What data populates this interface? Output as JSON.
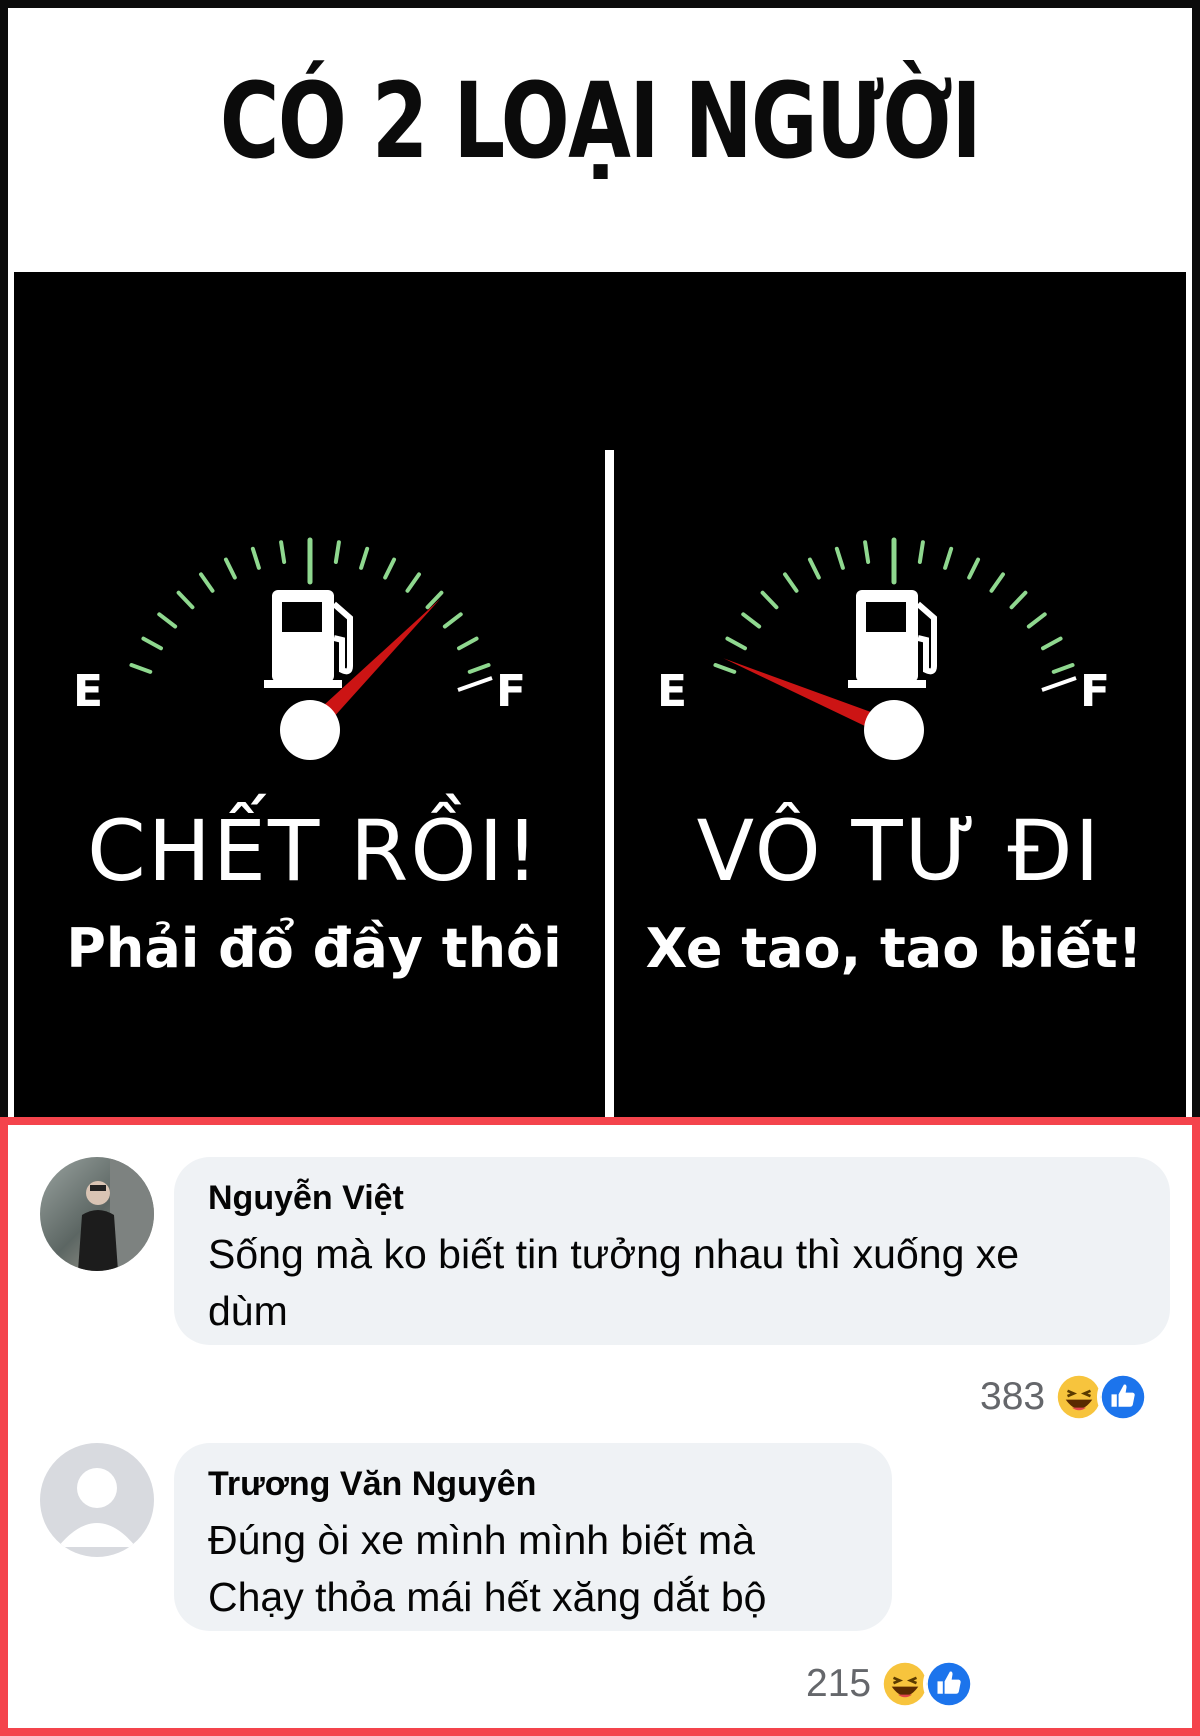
{
  "meme": {
    "title": "CÓ 2 LOẠI NGƯỜI",
    "left_gauge": {
      "empty_label": "E",
      "full_label": "F",
      "level": 0.82,
      "caption": "CHẾT RỒI!",
      "subcaption": "Phải đổ đầy thôi"
    },
    "right_gauge": {
      "empty_label": "E",
      "full_label": "F",
      "level": 0.02,
      "caption": "VÔ TƯ ĐI",
      "subcaption": "Xe tao, tao biết!"
    },
    "colors": {
      "tick": "#8fd88f",
      "needle": "#cc1414",
      "text": "#ffffff",
      "panel": "#000000"
    }
  },
  "comments": [
    {
      "author": "Nguyễn Việt",
      "lines": [
        "Sống mà ko biết tin tưởng nhau thì xuống xe",
        "dùm"
      ],
      "reaction_count": "383",
      "avatar_icon": "user-photo-avatar"
    },
    {
      "author": "Trương Văn Nguyên",
      "lines": [
        "Đúng òi xe mình mình biết mà",
        "Chạy thỏa mái hết xăng dắt bộ"
      ],
      "reaction_count": "215",
      "avatar_icon": "default-user-avatar"
    }
  ],
  "reaction_icons": [
    "haha-icon",
    "like-icon"
  ],
  "highlight_color": "#f4444c"
}
